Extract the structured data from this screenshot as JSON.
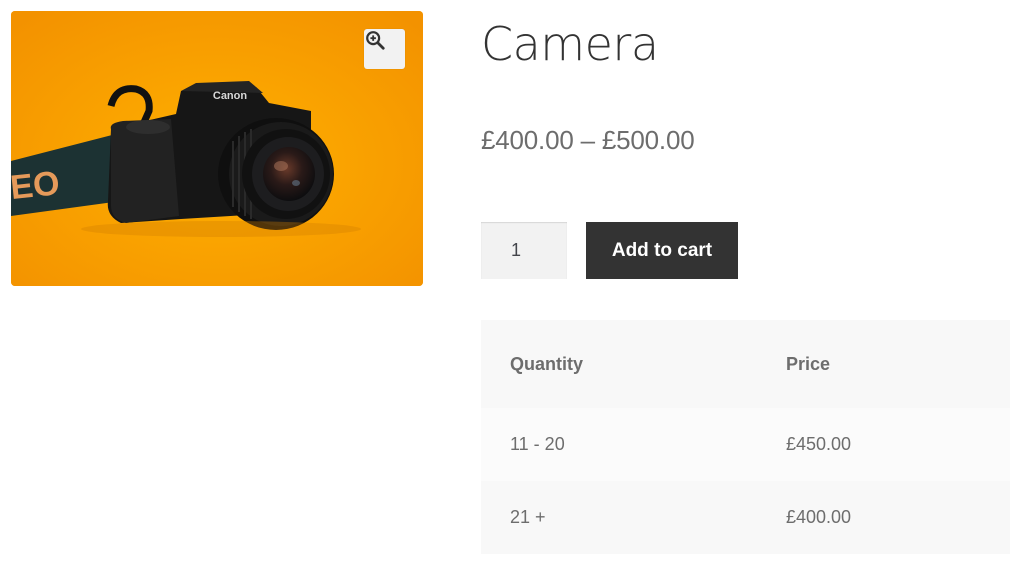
{
  "product": {
    "title": "Camera",
    "price_range": "£400.00 – £500.00",
    "image": {
      "description": "camera-photo",
      "background_color": "#f9a100",
      "brand_text": "Canon",
      "strap_text": "EO"
    },
    "zoom_icon": "zoom-in-icon"
  },
  "cart": {
    "quantity": "1",
    "add_to_cart_label": "Add to cart",
    "button_color": "#333333"
  },
  "pricing_table": {
    "headers": {
      "quantity": "Quantity",
      "price": "Price"
    },
    "rows": [
      {
        "quantity": "11 - 20",
        "price": "£450.00"
      },
      {
        "quantity": "21 +",
        "price": "£400.00"
      }
    ]
  }
}
